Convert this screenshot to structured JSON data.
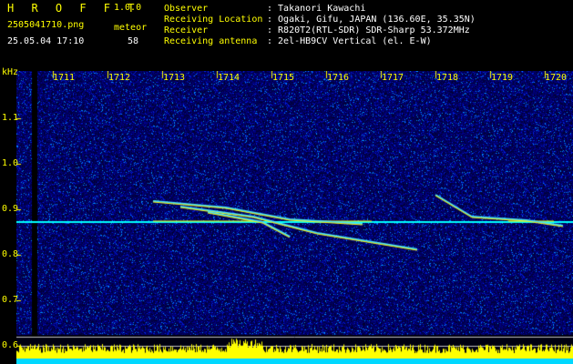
{
  "header": {
    "app_title": "H R O F F T",
    "app_version": "1.0.0",
    "filename": "2505041710.png",
    "timestamp": "25.05.04 17:10",
    "mode": "meteor",
    "count": "58"
  },
  "info": {
    "observer_label": "Observer",
    "observer_value": ": Takanori Kawachi",
    "location_label": "Receiving Location",
    "location_value": ": Ogaki, Gifu, JAPAN (136.60E, 35.35N)",
    "receiver_label": "Receiver",
    "receiver_value": ": R820T2(RTL-SDR) SDR-Sharp 53.372MHz",
    "antenna_label": "Receiving antenna",
    "antenna_value": ": 2el-HB9CV Vertical (el. E-W)"
  },
  "axis": {
    "y_unit": "kHz",
    "x_ticks": [
      "1711",
      "1712",
      "1713",
      "1714",
      "1715",
      "1716",
      "1717",
      "1718",
      "1719",
      "1720"
    ],
    "y_ticks": [
      "1.1",
      "1.0",
      "0.9",
      "0.8",
      "0.7",
      "0.6"
    ]
  },
  "colors": {
    "label_yellow": "#ffff00",
    "background": "#000000",
    "noise_blue": "#0000ff",
    "carrier_cyan": "#00ffff",
    "power_yellow": "#ffff00"
  }
}
